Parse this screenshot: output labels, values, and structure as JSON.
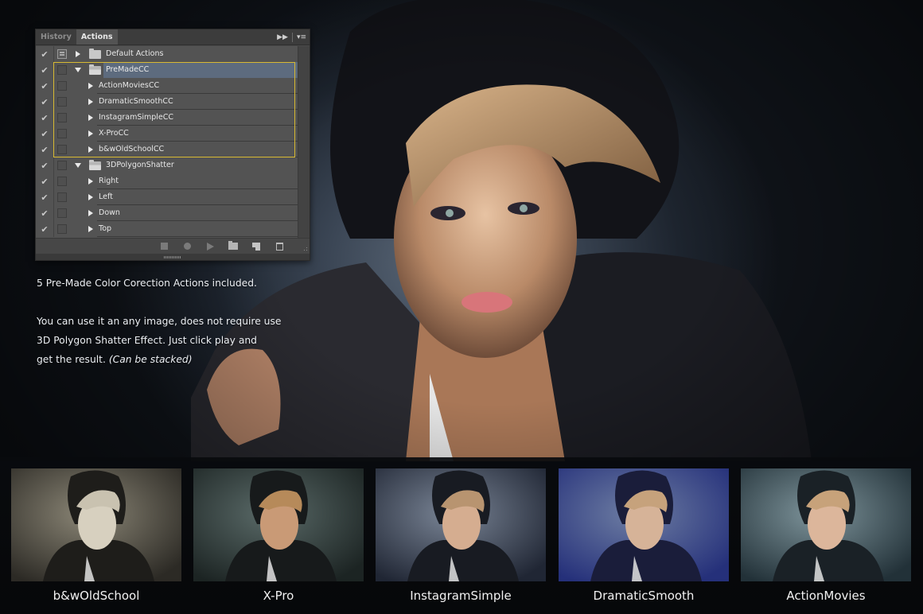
{
  "panel": {
    "tabs": [
      {
        "label": "History",
        "active": false
      },
      {
        "label": "Actions",
        "active": true
      }
    ],
    "header_icons": [
      "collapse-icon",
      "panel-menu-icon"
    ],
    "rows": [
      {
        "type": "set",
        "label": "Default Actions",
        "expanded": false,
        "checked": true,
        "dialog_toggle": true,
        "selected": false
      },
      {
        "type": "set",
        "label": "PreMadeCC",
        "expanded": true,
        "checked": true,
        "dialog_toggle": false,
        "selected": true
      },
      {
        "type": "action",
        "label": "ActionMoviesCC",
        "checked": true
      },
      {
        "type": "action",
        "label": "DramaticSmoothCC",
        "checked": true
      },
      {
        "type": "action",
        "label": "InstagramSimpleCC",
        "checked": true
      },
      {
        "type": "action",
        "label": "X-ProCC",
        "checked": true
      },
      {
        "type": "action",
        "label": "b&wOldSchoolCC",
        "checked": true
      },
      {
        "type": "set",
        "label": "3DPolygonShatter",
        "expanded": true,
        "checked": true,
        "dialog_toggle": false,
        "selected": false
      },
      {
        "type": "action",
        "label": "Right",
        "checked": true
      },
      {
        "type": "action",
        "label": "Left",
        "checked": true
      },
      {
        "type": "action",
        "label": "Down",
        "checked": true
      },
      {
        "type": "action",
        "label": "Top",
        "checked": true
      }
    ],
    "footer_buttons": [
      "stop-icon",
      "record-icon",
      "play-icon",
      "new-set-icon",
      "new-action-icon",
      "delete-icon"
    ],
    "highlight_color": "#d7b933",
    "selected_color": "#5d6b7e"
  },
  "description": {
    "line1": "5 Pre-Made Color Corection Actions included.",
    "line2": "You can use it an any image, does not require use",
    "line3": "3D Polygon Shatter Effect. Just click play and",
    "line4": "get the result.",
    "line4_italic": "(Can be stacked)"
  },
  "thumbnails": [
    {
      "label": "b&wOldSchool",
      "tone": "sepia"
    },
    {
      "label": "X-Pro",
      "tone": "teal-warm"
    },
    {
      "label": "InstagramSimple",
      "tone": "cool-gray"
    },
    {
      "label": "DramaticSmooth",
      "tone": "blue"
    },
    {
      "label": "ActionMovies",
      "tone": "teal"
    }
  ]
}
